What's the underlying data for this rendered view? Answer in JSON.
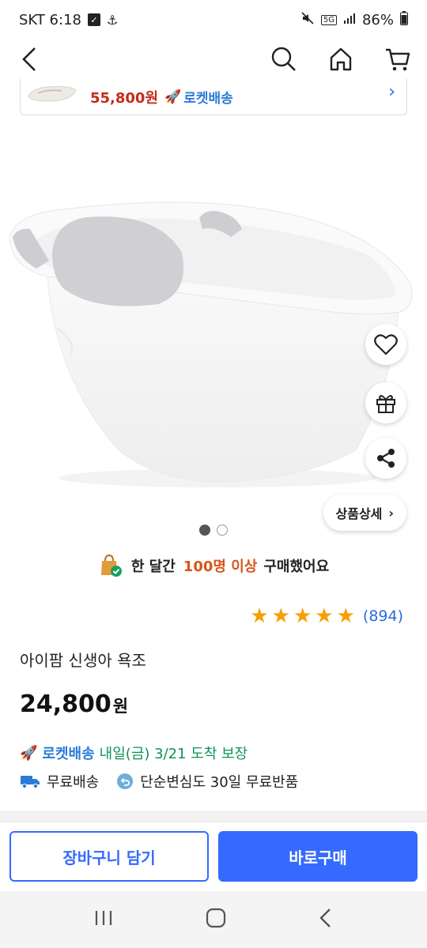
{
  "status": {
    "carrier_time": "SKT 6:18",
    "network": "5G",
    "battery": "86%"
  },
  "banner": {
    "price": "55,800원",
    "delivery": "로켓배송"
  },
  "buttons": {
    "detail": "상품상세"
  },
  "buyers": {
    "prefix": "한 달간",
    "highlight": "100명 이상",
    "suffix": "구매했어요"
  },
  "rating": {
    "stars": 5,
    "count": "(894)"
  },
  "product": {
    "title": "아이팜 신생아 욕조",
    "price": "24,800",
    "currency": "원"
  },
  "delivery": {
    "rocket": "로켓배송",
    "eta": "내일(금) 3/21 도착 보장"
  },
  "benefits": {
    "free_shipping": "무료배송",
    "free_return": "단순변심도 30일 무료반품"
  },
  "cta": {
    "cart": "장바구니 담기",
    "buy": "바로구매"
  },
  "colors": {
    "accent": "#346aff",
    "price_red": "#c62a1a",
    "rocket_blue": "#2a7bd9",
    "star": "#f5a000",
    "eta_green": "#0e9356"
  }
}
